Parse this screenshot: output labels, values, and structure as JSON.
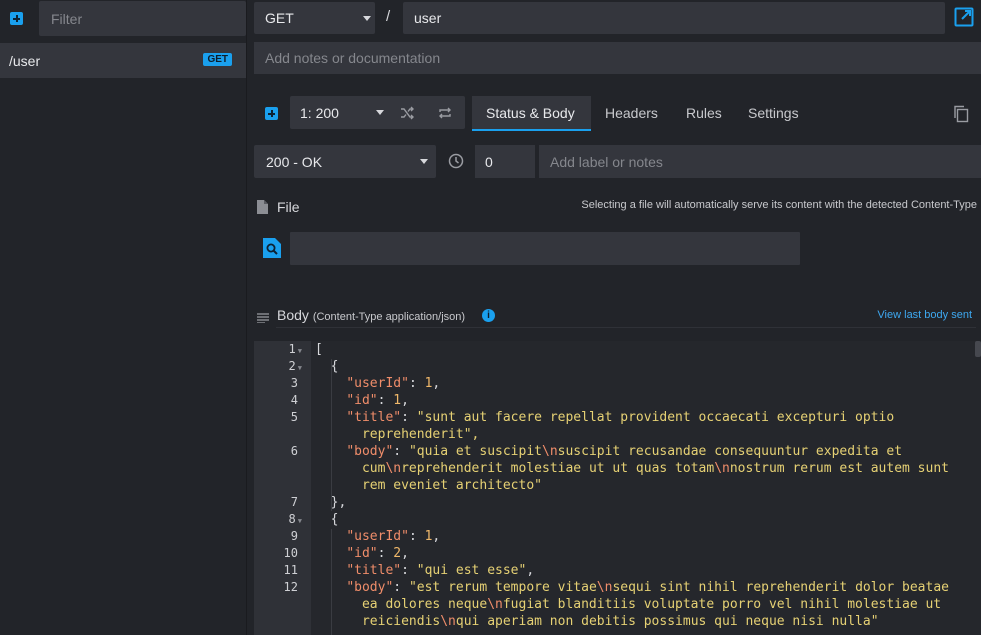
{
  "sidebar": {
    "filter_placeholder": "Filter",
    "routes": [
      {
        "path": "/user",
        "method_badge": "GET"
      }
    ]
  },
  "route": {
    "method": "GET",
    "prefix_slash": "/",
    "endpoint": "user",
    "notes_placeholder": "Add notes or documentation"
  },
  "response": {
    "selected": "1: 200",
    "tabs": [
      "Status & Body",
      "Headers",
      "Rules",
      "Settings"
    ],
    "active_tab": "Status & Body",
    "status": "200 - OK",
    "latency": "0",
    "label_placeholder": "Add label or notes"
  },
  "file": {
    "title": "File",
    "hint": "Selecting a file will automatically serve its content with the detected Content-Type"
  },
  "body": {
    "title": "Body",
    "content_type": "(Content-Type application/json)",
    "info": "i",
    "view_last": "View last body sent"
  },
  "editor": {
    "line_numbers": [
      "1",
      "2",
      "3",
      "4",
      "5",
      "6",
      "7",
      "8",
      "9",
      "10",
      "11",
      "12"
    ],
    "code_lines": [
      "[",
      "  {",
      "    \"userId\": 1,",
      "    \"id\": 1,",
      "    \"title\": \"sunt aut facere repellat provident occaecati excepturi optio",
      "      reprehenderit\",",
      "    \"body\": \"quia et suscipit\\nsuscipit recusandae consequuntur expedita et",
      "      cum\\nreprehenderit molestiae ut ut quas totam\\nnostrum rerum est autem sunt",
      "      rem eveniet architecto\"",
      "  },",
      "  {",
      "    \"userId\": 1,",
      "    \"id\": 2,",
      "    \"title\": \"qui est esse\",",
      "    \"body\": \"est rerum tempore vitae\\nsequi sint nihil reprehenderit dolor beatae",
      "      ea dolores neque\\nfugiat blanditiis voluptate porro vel nihil molestiae ut",
      "      reiciendis\\nqui aperiam non debitis possimus qui neque nisi nulla\""
    ]
  },
  "colors": {
    "accent": "#1aa0ee",
    "panel": "#34363d",
    "background": "#222429",
    "json_key": "#f08d6a",
    "json_string": "#e6d174",
    "json_number": "#f0b86a"
  },
  "icons": [
    "add-route-icon",
    "caret-down-icon",
    "external-link-icon",
    "add-response-icon",
    "shuffle-icon",
    "repeat-icon",
    "duplicate-icon",
    "clock-icon",
    "file-icon",
    "file-search-icon",
    "body-lines-icon",
    "info-icon",
    "fold-arrow-icon"
  ]
}
